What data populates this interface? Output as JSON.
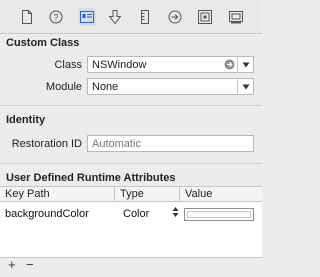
{
  "toolbar": {
    "icons": [
      "file-icon",
      "help-icon",
      "identity-icon",
      "attributes-icon",
      "size-ruler-icon",
      "connections-icon",
      "bindings-icon",
      "effects-icon"
    ],
    "active": "identity-icon"
  },
  "custom_class": {
    "title": "Custom Class",
    "class_label": "Class",
    "class_value": "NSWindow",
    "module_label": "Module",
    "module_value": "None"
  },
  "identity": {
    "title": "Identity",
    "restoration_label": "Restoration ID",
    "restoration_placeholder": "Automatic"
  },
  "runtime_attributes": {
    "title": "User Defined Runtime Attributes",
    "columns": [
      "Key Path",
      "Type",
      "Value"
    ],
    "rows": [
      {
        "key_path": "backgroundColor",
        "type": "Color",
        "value": ""
      }
    ],
    "add_label": "+",
    "remove_label": "−"
  }
}
